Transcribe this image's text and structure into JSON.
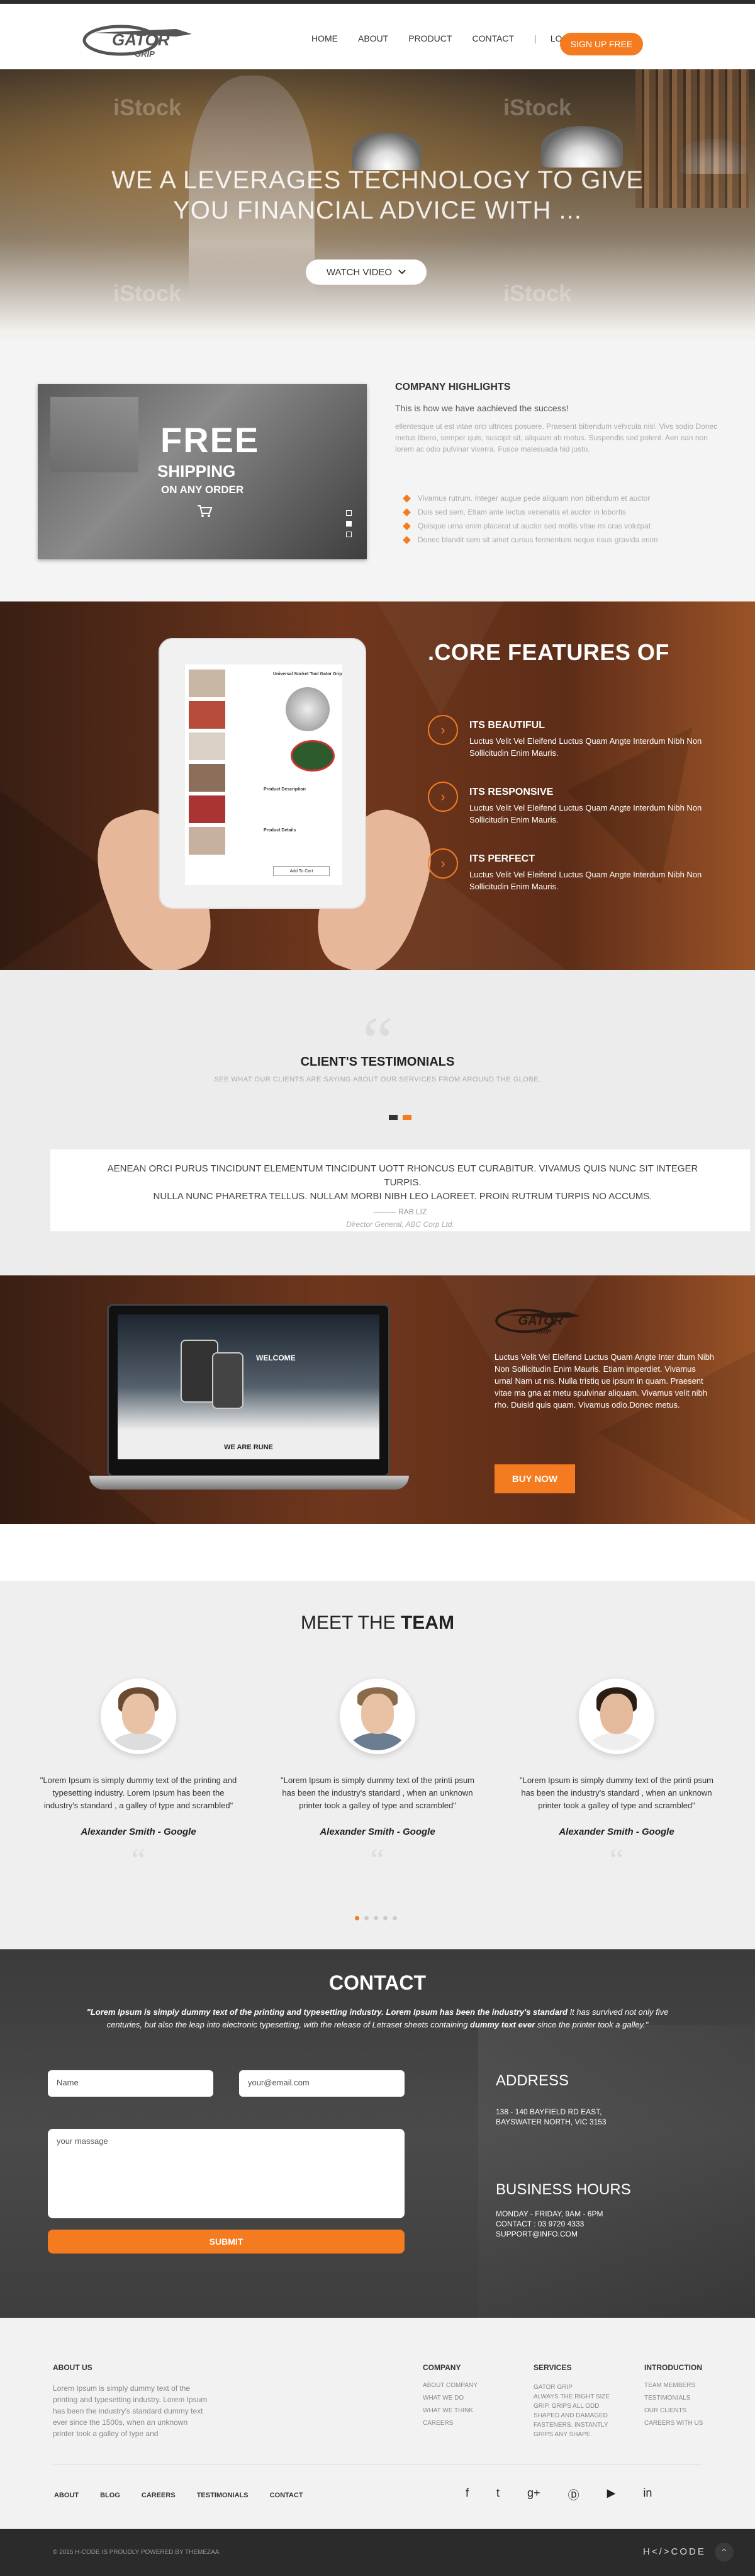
{
  "header": {
    "logo_text": "GATOR",
    "logo_sub": "GRIP",
    "nav": [
      "HOME",
      "ABOUT",
      "PRODUCT",
      "CONTACT"
    ],
    "separator": "|",
    "login": "LOGIN",
    "signup": "SIGN UP FREE"
  },
  "hero": {
    "title_line1": "WE A LEVERAGES TECHNOLOGY TO GIVE",
    "title_line2": "YOU FINANCIAL  ADVICE WITH ...",
    "watch_label": "WATCH VIDEO",
    "watermark": "iStock"
  },
  "highlights": {
    "promo_line1": "FREE",
    "promo_line2": "SHIPPING",
    "promo_line3": "ON ANY ORDER",
    "title": "COMPANY HIGHLIGHTS",
    "subtitle": "This is how we have aachieved the success!",
    "paragraph": "ellentesque ut est vitae orci ultrices posuere. Praesent bibendum vehicula nisl. Vivs sodio Donec metus libero, semper quis, suscipit sit, aliquam ab metus. Suspendis sed potent. Aen ean non lorem ac odio pulvinar viverra. Fusce malesuada hid justo.",
    "bullets": [
      "Vivamus rutrum. Integer augue pede aliquam non bibendum et auctor",
      "Duis sed sem. Etiam ante lectus venenatis et auctor in lobortis",
      "Quisque urna enim placerat ut auctor sed mollis vitae mi cras volutpat",
      "Donec blandit sem sit amet cursus fermentum neque risus gravida enim"
    ]
  },
  "features": {
    "title": ".CORE FEATURES OF",
    "items": [
      {
        "heading": "ITS BEAUTIFUL",
        "text": "Luctus Velit Vel Eleifend Luctus Quam Angte Interdum Nibh Non Sollicitudin Enim Mauris."
      },
      {
        "heading": "ITS RESPONSIVE",
        "text": "Luctus Velit Vel Eleifend Luctus Quam Angte Interdum Nibh Non Sollicitudin Enim Mauris."
      },
      {
        "heading": "ITS PERFECT",
        "text": "Luctus Velit Vel Eleifend Luctus Quam Angte Interdum Nibh Non Sollicitudin Enim Mauris."
      }
    ],
    "tablet_title": "Universal Socket Tool Gator Grip",
    "tablet_list": [
      "Product Description",
      "Product Details"
    ],
    "tablet_btn": "Add To Cart"
  },
  "testimonials": {
    "title": "CLIENT'S TESTIMONIALS",
    "subtitle": "SEE WHAT OUR CLIENTS ARE SAYING ABOUT OUR SERVICES FROM AROUND THE GLOBE.",
    "quote_line1": "AENEAN ORCI PURUS TINCIDUNT ELEMENTUM TINCIDUNT UOTT RHONCUS EUT CURABITUR. VIVAMUS QUIS NUNC SIT INTEGER TURPIS.",
    "quote_line2": "NULLA NUNC PHARETRA TELLUS. NULLAM MORBI NIBH LEO LAOREET. PROIN RUTRUM TURPIS NO ACCUMS.",
    "name": "RAB LIZ",
    "role": "Director General, ABC Corp Ltd."
  },
  "product": {
    "logo_text": "GATOR",
    "logo_sub": "GRIP",
    "text": "Luctus Velit Vel Eleifend Luctus Quam Angte Inter dtum Nibh Non Sollicitudin Enim Mauris. Etiam imperdiet. Vivamus urnal Nam ut nis. Nulla tristiq ue ipsum in quam. Praesent vitae ma gna at metu spulvinar aliquam. Vivamus velit nibh rho. Duisld quis quam. Vivamus odio.Donec metus.",
    "buy": "BUY NOW",
    "screen_welcome": "WELCOME",
    "screen_banner": "WE ARE RUNE"
  },
  "team": {
    "title_light": "MEET THE ",
    "title_bold": "TEAM",
    "members": [
      {
        "text": "\"Lorem Ipsum is simply dummy text of the printing and typesetting industry. Lorem Ipsum has been the industry's standard , a galley of type and scrambled\"",
        "name": "Alexander Smith - Google"
      },
      {
        "text": "\"Lorem Ipsum is simply dummy text of the printi psum has been the industry's standard , when an unknown printer took a galley of type and scrambled\"",
        "name": "Alexander Smith - Google"
      },
      {
        "text": "\"Lorem Ipsum is simply dummy text of the printi psum has been the industry's standard , when an unknown printer took a galley of type and scrambled\"",
        "name": "Alexander Smith - Google"
      }
    ]
  },
  "contact": {
    "title": "CONTACT",
    "sub_bold1": "\"Lorem Ipsum is simply dummy text of the printing and typesetting industry. Lorem Ipsum has been the industry's standard",
    "sub_plain1": " It has survived not only five centuries, but also the leap into electronic typesetting, with the release of Letraset sheets containing ",
    "sub_bold2": "dummy text ever",
    "sub_plain2": " since the  printer took a galley.\"",
    "name_placeholder": "Name",
    "email_placeholder": "your@email.com",
    "message_placeholder": "your massage",
    "submit": "SUBMIT",
    "address_title": "ADDRESS",
    "address_line1": "138 - 140 BAYFIELD RD EAST,",
    "address_line2": "BAYSWATER NORTH, VIC 3153",
    "hours_title": "BUSINESS HOURS",
    "hours_line1": "MONDAY - FRIDAY, 9AM - 6PM",
    "hours_line2": "CONTACT : 03 9720 4333",
    "hours_line3": "SUPPORT@INFO.COM"
  },
  "footer": {
    "about_title": "ABOUT US",
    "about_text": "Lorem Ipsum is simply dummy text of the printing and typesetting industry. Lorem Ipsum has been the industry's standard dummy text ever since the 1500s, when an unknown printer took a galley of type and",
    "company_title": "COMPANY",
    "company_items": [
      "ABOUT COMPANY",
      "WHAT WE DO",
      "WHAT WE THINK",
      "CAREERS"
    ],
    "services_title": "SERVICES",
    "services_items": [
      "GATOR GRIP",
      "ALWAYS THE RIGHT SIZE",
      "GRIP. GRIPS ALL ODD",
      "SHAPED AND DAMAGED",
      "FASTENERS. INSTANTLY",
      "GRIPS ANY SHAPE."
    ],
    "intro_title": "INTRODUCTION",
    "intro_items": [
      "TEAM MEMBERS",
      "TESTIMONIALS",
      "OUR CLIENTS",
      "CAREERS WITH US"
    ],
    "links": [
      "ABOUT",
      "BLOG",
      "CAREERS",
      "TESTIMONIALS",
      "CONTACT"
    ],
    "social": [
      "f",
      "t",
      "g+",
      "Ⓓ",
      "▶",
      "in"
    ],
    "copyright": "© 2015 H-CODE IS PROUDLY POWERED BY THEMEZAA",
    "brand": "H</>CODE",
    "top_arrow": "⌃"
  },
  "colors": {
    "accent": "#f47b1f",
    "dark": "#2b2b2b"
  }
}
